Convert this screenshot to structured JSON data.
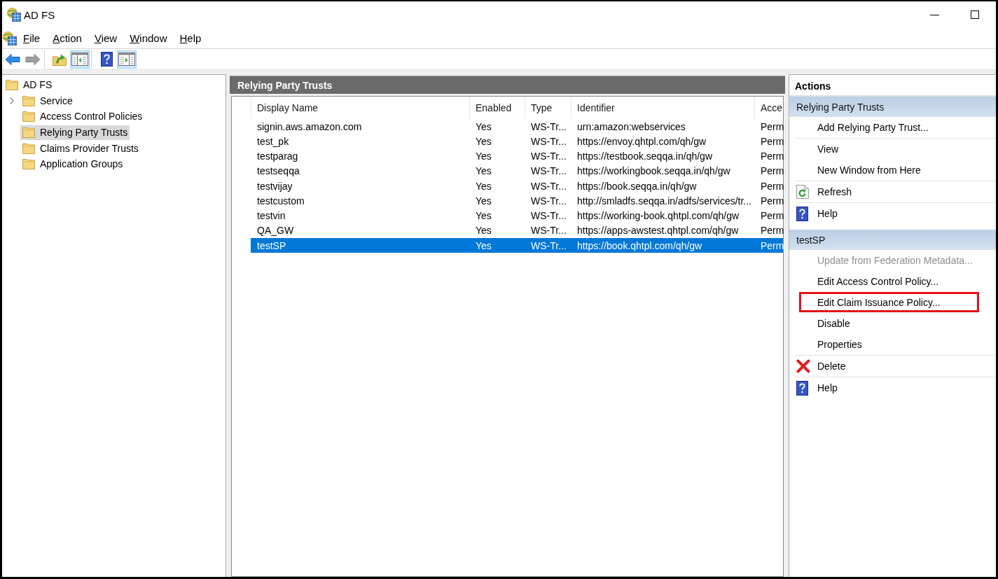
{
  "window": {
    "title": "AD FS"
  },
  "menu": [
    "File",
    "Action",
    "View",
    "Window",
    "Help"
  ],
  "toolbar": {
    "groups": [
      {
        "buttons": [
          {
            "kind": "back",
            "disabled": false,
            "on": false
          },
          {
            "kind": "forward",
            "disabled": true,
            "on": false
          }
        ]
      },
      {
        "buttons": [
          {
            "kind": "up",
            "disabled": false,
            "on": false
          },
          {
            "kind": "tree",
            "disabled": false,
            "on": true
          }
        ]
      },
      {
        "buttons": [
          {
            "kind": "help",
            "disabled": false,
            "on": false
          },
          {
            "kind": "actions",
            "disabled": false,
            "on": true
          }
        ]
      }
    ]
  },
  "tree": [
    {
      "label": "AD FS",
      "selected": false,
      "collapsed": false,
      "children": [
        {
          "label": "Service",
          "selected": false,
          "collapsed": true
        },
        {
          "label": "Access Control Policies",
          "selected": false,
          "collapsed": false
        },
        {
          "label": "Relying Party Trusts",
          "selected": true,
          "collapsed": false
        },
        {
          "label": "Claims Provider Trusts",
          "selected": false,
          "collapsed": false
        },
        {
          "label": "Application Groups",
          "selected": false,
          "collapsed": false
        }
      ]
    }
  ],
  "results": {
    "title": "Relying Party Trusts",
    "columns": [
      "Display Name",
      "Enabled",
      "Type",
      "Identifier",
      "Acce"
    ],
    "rows": [
      {
        "cells": [
          "signin.aws.amazon.com",
          "Yes",
          "WS-Tr...",
          "urn:amazon:webservices",
          "Perm"
        ],
        "selected": false
      },
      {
        "cells": [
          "test_pk",
          "Yes",
          "WS-Tr...",
          "https://envoy.qhtpl.com/qh/gw",
          "Perm"
        ],
        "selected": false
      },
      {
        "cells": [
          "testparag",
          "Yes",
          "WS-Tr...",
          "https://testbook.seqqa.in/qh/gw",
          "Perm"
        ],
        "selected": false
      },
      {
        "cells": [
          "testseqqa",
          "Yes",
          "WS-Tr...",
          "https://workingbook.seqqa.in/qh/gw",
          "Perm"
        ],
        "selected": false
      },
      {
        "cells": [
          "testvijay",
          "Yes",
          "WS-Tr...",
          "https://book.seqqa.in/qh/gw",
          "Perm"
        ],
        "selected": false
      },
      {
        "cells": [
          "testcustom",
          "Yes",
          "WS-Tr...",
          "http://smladfs.seqqa.in/adfs/services/tr...",
          "Perm"
        ],
        "selected": false
      },
      {
        "cells": [
          "testvin",
          "Yes",
          "WS-Tr...",
          "https://working-book.qhtpl.com/qh/gw",
          "Perm"
        ],
        "selected": false
      },
      {
        "cells": [
          "QA_GW",
          "Yes",
          "WS-Tr...",
          "https://apps-awstest.qhtpl.com/qh/gw",
          "Perm"
        ],
        "selected": false
      },
      {
        "cells": [
          "testSP",
          "Yes",
          "WS-Tr...",
          "https://book.qhtpl.com/qh/gw",
          "Perm"
        ],
        "selected": true
      }
    ]
  },
  "actions": {
    "title": "Actions",
    "sections": [
      {
        "title": "Relying Party Trusts",
        "groups": [
          [
            {
              "label": "Add Relying Party Trust...",
              "kind": "plain",
              "disabled": false,
              "highlighted": false
            }
          ],
          [
            {
              "label": "View",
              "kind": "plain",
              "disabled": false,
              "highlighted": false
            },
            {
              "label": "New Window from Here",
              "kind": "plain",
              "disabled": false,
              "highlighted": false
            }
          ],
          [
            {
              "label": "Refresh",
              "kind": "refresh",
              "disabled": false,
              "highlighted": false
            }
          ],
          [
            {
              "label": "Help",
              "kind": "help",
              "disabled": false,
              "highlighted": false
            }
          ]
        ]
      },
      {
        "title": "testSP",
        "groups": [
          [
            {
              "label": "Update from Federation Metadata...",
              "kind": "plain",
              "disabled": true,
              "highlighted": false
            },
            {
              "label": "Edit Access Control Policy...",
              "kind": "plain",
              "disabled": false,
              "highlighted": false
            },
            {
              "label": "Edit Claim Issuance Policy...",
              "kind": "plain",
              "disabled": false,
              "highlighted": true
            },
            {
              "label": "Disable",
              "kind": "plain",
              "disabled": false,
              "highlighted": false
            },
            {
              "label": "Properties",
              "kind": "plain",
              "disabled": false,
              "highlighted": false
            }
          ],
          [
            {
              "label": "Delete",
              "kind": "delete",
              "disabled": false,
              "highlighted": false
            }
          ],
          [
            {
              "label": "Help",
              "kind": "help",
              "disabled": false,
              "highlighted": false
            }
          ]
        ]
      }
    ]
  }
}
